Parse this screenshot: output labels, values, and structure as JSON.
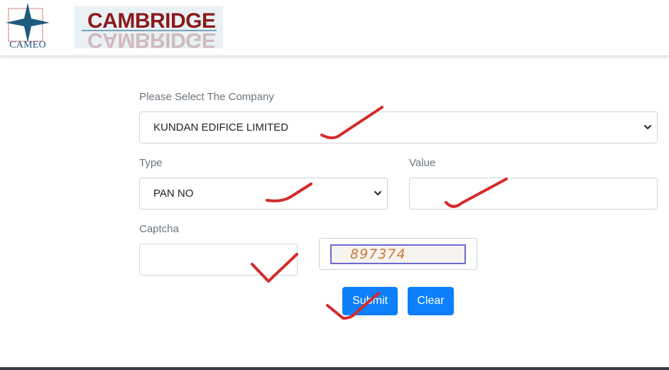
{
  "header": {
    "cameo_logo_text": "CAMEO",
    "cambridge_logo_text": "CAMBRIDGE"
  },
  "form": {
    "company": {
      "label": "Please Select The Company",
      "selected": "KUNDAN EDIFICE LIMITED"
    },
    "type": {
      "label": "Type",
      "selected": "PAN NO"
    },
    "value": {
      "label": "Value",
      "current_value": ""
    },
    "captcha": {
      "label": "Captcha",
      "current_value": "",
      "code": "897374"
    },
    "buttons": {
      "submit": "Submit",
      "clear": "Clear"
    }
  },
  "colors": {
    "primary_button": "#0d7ffb",
    "label_text": "#6c757d",
    "annotation_marks": "#d42a2a",
    "cameo_blue": "#1f4f7a",
    "cambridge_red": "#8b1a1a"
  }
}
